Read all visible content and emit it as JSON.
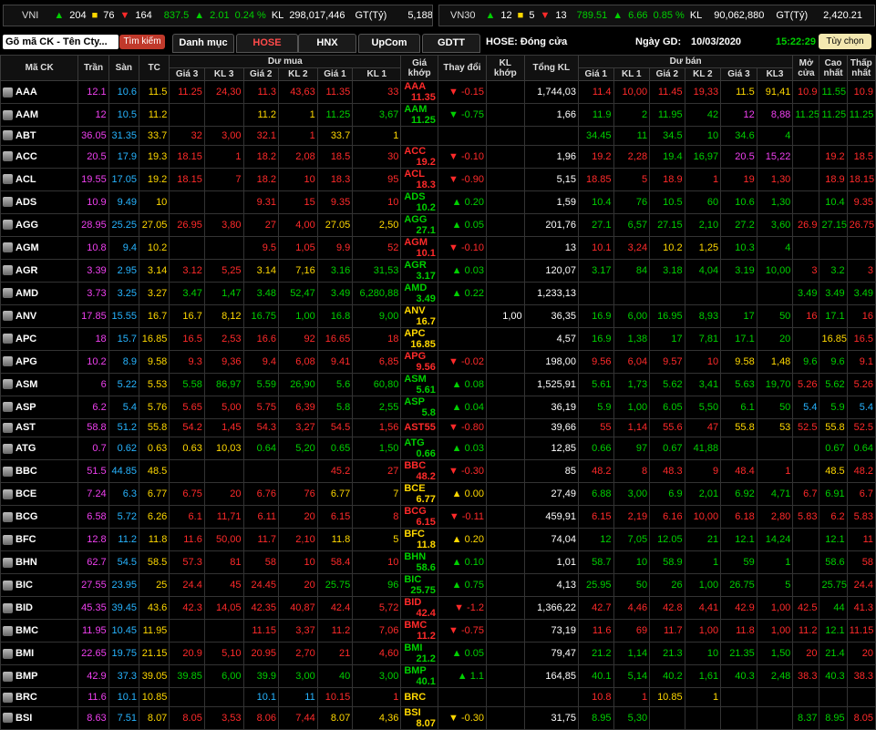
{
  "indices": [
    {
      "name": "VNI",
      "up_count": "204",
      "ref_count": "76",
      "down_count": "164",
      "value": "837.5",
      "change": "2.01",
      "pct": "0.24 %",
      "kl_label": "KL",
      "kl": "298,017,446",
      "gt_label": "GT(Tỷ)",
      "gt": "5,188.53"
    },
    {
      "name": "VN30",
      "up_count": "12",
      "ref_count": "5",
      "down_count": "13",
      "value": "789.51",
      "change": "6.66",
      "pct": "0.85 %",
      "kl_label": "KL",
      "kl": "90,062,880",
      "gt_label": "GT(Tỷ)",
      "gt": "2,420.21"
    }
  ],
  "toolbar": {
    "search_placeholder": "Gõ mã CK - Tên Cty...",
    "search_button": "Tìm kiếm",
    "tabs": [
      "Danh mục",
      "HOSE",
      "HNX",
      "UpCom",
      "GDTT"
    ],
    "market_status": "HOSE: Đóng cửa",
    "date_label": "Ngày GD:",
    "date": "10/03/2020",
    "clock": "15:22:29",
    "custom_button": "Tùy chọn"
  },
  "columns": {
    "code": "Mã CK",
    "ceil": "Trần",
    "floor": "Sàn",
    "ref": "TC",
    "buy_group": "Dư mua",
    "buy": [
      "Giá 3",
      "KL 3",
      "Giá 2",
      "KL 2",
      "Giá 1",
      "KL 1"
    ],
    "match_price": "Giá khớp",
    "change": "Thay đổi",
    "match_vol": "KL khớp",
    "total_vol": "Tổng KL",
    "sell_group": "Dư bán",
    "sell": [
      "Giá 1",
      "KL 1",
      "Giá 2",
      "KL 2",
      "Giá 3",
      "KL3"
    ],
    "open": "Mở cửa",
    "high": "Cao nhất",
    "low": "Thấp nhất"
  },
  "colors": {
    "up": "#00d000",
    "down": "#ff2a2a",
    "ref": "#ffd800",
    "ceil": "#f040f0",
    "floor": "#27b4ff"
  },
  "rows": [
    [
      "AAA",
      "12.1",
      "10.6",
      "11.5",
      "11.25",
      "24,30",
      "11.3",
      "43,63",
      "11.35",
      "33",
      "11.35",
      "▼ -0.15",
      "",
      "1,744,03",
      "11.4",
      "10,00",
      "11.45",
      "19,33",
      "11.5",
      "91,41",
      "10.9",
      "11.55",
      "10.9"
    ],
    [
      "AAM",
      "12",
      "10.5",
      "11.2",
      "",
      "",
      "11.2",
      "1",
      "11.25",
      "3,67",
      "11.25",
      "▼ -0.75",
      "",
      "1,66",
      "11.9",
      "2",
      "11.95",
      "42",
      "12",
      "8,88",
      "11.25",
      "11.25",
      "11.25"
    ],
    [
      "ABT",
      "36.05",
      "31.35",
      "33.7",
      "32",
      "3,00",
      "32.1",
      "1",
      "33.7",
      "1",
      "",
      "",
      "",
      "",
      "34.45",
      "11",
      "34.5",
      "10",
      "34.6",
      "4",
      "",
      "",
      ""
    ],
    [
      "ACC",
      "20.5",
      "17.9",
      "19.3",
      "18.15",
      "1",
      "18.2",
      "2,08",
      "18.5",
      "30",
      "19.2",
      "▼ -0.10",
      "",
      "1,96",
      "19.2",
      "2,28",
      "19.4",
      "16,97",
      "20.5",
      "15,22",
      "",
      "19.2",
      "18.5"
    ],
    [
      "ACL",
      "19.55",
      "17.05",
      "19.2",
      "18.15",
      "7",
      "18.2",
      "10",
      "18.3",
      "95",
      "18.3",
      "▼ -0.90",
      "",
      "5,15",
      "18.85",
      "5",
      "18.9",
      "1",
      "19",
      "1,30",
      "",
      "18.9",
      "18.15"
    ],
    [
      "ADS",
      "10.9",
      "9.49",
      "10",
      "",
      "",
      "9.31",
      "15",
      "9.35",
      "10",
      "10.2",
      "▲ 0.20",
      "",
      "1,59",
      "10.4",
      "76",
      "10.5",
      "60",
      "10.6",
      "1,30",
      "",
      "10.4",
      "9.35"
    ],
    [
      "AGG",
      "28.95",
      "25.25",
      "27.05",
      "26.95",
      "3,80",
      "27",
      "4,00",
      "27.05",
      "2,50",
      "27.1",
      "▲ 0.05",
      "",
      "201,76",
      "27.1",
      "6,57",
      "27.15",
      "2,10",
      "27.2",
      "3,60",
      "26.9",
      "27.15",
      "26.75"
    ],
    [
      "AGM",
      "10.8",
      "9.4",
      "10.2",
      "",
      "",
      "9.5",
      "1,05",
      "9.9",
      "52",
      "10.1",
      "▼ -0.10",
      "",
      "13",
      "10.1",
      "3,24",
      "10.2",
      "1,25",
      "10.3",
      "4",
      "",
      "",
      ""
    ],
    [
      "AGR",
      "3.39",
      "2.95",
      "3.14",
      "3.12",
      "5,25",
      "3.14",
      "7,16",
      "3.16",
      "31,53",
      "3.17",
      "▲ 0.03",
      "",
      "120,07",
      "3.17",
      "84",
      "3.18",
      "4,04",
      "3.19",
      "10,00",
      "3",
      "3.2",
      "3"
    ],
    [
      "AMD",
      "3.73",
      "3.25",
      "3.27",
      "3.47",
      "1,47",
      "3.48",
      "52,47",
      "3.49",
      "6,280,88",
      "3.49",
      "▲ 0.22",
      "",
      "1,233,13",
      "",
      "",
      "",
      "",
      "",
      "",
      "3.49",
      "3.49",
      "3.49"
    ],
    [
      "ANV",
      "17.85",
      "15.55",
      "16.7",
      "16.7",
      "8,12",
      "16.75",
      "1,00",
      "16.8",
      "9,00",
      "16.7",
      "",
      "1,00",
      "36,35",
      "16.9",
      "6,00",
      "16.95",
      "8,93",
      "17",
      "50",
      "16",
      "17.1",
      "16"
    ],
    [
      "APC",
      "18",
      "15.7",
      "16.85",
      "16.5",
      "2,53",
      "16.6",
      "92",
      "16.65",
      "18",
      "16.85",
      "",
      "",
      "4,57",
      "16.9",
      "1,38",
      "17",
      "7,81",
      "17.1",
      "20",
      "",
      "16.85",
      "16.5"
    ],
    [
      "APG",
      "10.2",
      "8.9",
      "9.58",
      "9.3",
      "9,36",
      "9.4",
      "6,08",
      "9.41",
      "6,85",
      "9.56",
      "▼ -0.02",
      "",
      "198,00",
      "9.56",
      "6,04",
      "9.57",
      "10",
      "9.58",
      "1,48",
      "9.6",
      "9.6",
      "9.1"
    ],
    [
      "ASM",
      "6",
      "5.22",
      "5.53",
      "5.58",
      "86,97",
      "5.59",
      "26,90",
      "5.6",
      "60,80",
      "5.61",
      "▲ 0.08",
      "",
      "1,525,91",
      "5.61",
      "1,73",
      "5.62",
      "3,41",
      "5.63",
      "19,70",
      "5.26",
      "5.62",
      "5.26"
    ],
    [
      "ASP",
      "6.2",
      "5.4",
      "5.76",
      "5.65",
      "5,00",
      "5.75",
      "6,39",
      "5.8",
      "2,55",
      "5.8",
      "▲ 0.04",
      "",
      "36,19",
      "5.9",
      "1,00",
      "6.05",
      "5,50",
      "6.1",
      "50",
      "5.4",
      "5.9",
      "5.4"
    ],
    [
      "AST",
      "58.8",
      "51.2",
      "55.8",
      "54.2",
      "1,45",
      "54.3",
      "3,27",
      "54.5",
      "1,56",
      "55",
      "▼ -0.80",
      "",
      "39,66",
      "55",
      "1,14",
      "55.6",
      "47",
      "55.8",
      "53",
      "52.5",
      "55.8",
      "52.5"
    ],
    [
      "ATG",
      "0.7",
      "0.62",
      "0.63",
      "0.63",
      "10,03",
      "0.64",
      "5,20",
      "0.65",
      "1,50",
      "0.66",
      "▲ 0.03",
      "",
      "12,85",
      "0.66",
      "97",
      "0.67",
      "41,88",
      "",
      "",
      "",
      "0.67",
      "0.64"
    ],
    [
      "BBC",
      "51.5",
      "44.85",
      "48.5",
      "",
      "",
      "",
      "",
      "45.2",
      "27",
      "48.2",
      "▼ -0.30",
      "",
      "85",
      "48.2",
      "8",
      "48.3",
      "9",
      "48.4",
      "1",
      "",
      "48.5",
      "48.2"
    ],
    [
      "BCE",
      "7.24",
      "6.3",
      "6.77",
      "6.75",
      "20",
      "6.76",
      "76",
      "6.77",
      "7",
      "6.77",
      "▲ 0.00",
      "",
      "27,49",
      "6.88",
      "3,00",
      "6.9",
      "2,01",
      "6.92",
      "4,71",
      "6.7",
      "6.91",
      "6.7"
    ],
    [
      "BCG",
      "6.58",
      "5.72",
      "6.26",
      "6.1",
      "11,71",
      "6.11",
      "20",
      "6.15",
      "8",
      "6.15",
      "▼ -0.11",
      "",
      "459,91",
      "6.15",
      "2,19",
      "6.16",
      "10,00",
      "6.18",
      "2,80",
      "5.83",
      "6.2",
      "5.83"
    ],
    [
      "BFC",
      "12.8",
      "11.2",
      "11.8",
      "11.6",
      "50,00",
      "11.7",
      "2,10",
      "11.8",
      "5",
      "11.8",
      "▲ 0.20",
      "",
      "74,04",
      "12",
      "7,05",
      "12.05",
      "21",
      "12.1",
      "14,24",
      "",
      "12.1",
      "11"
    ],
    [
      "BHN",
      "62.7",
      "54.5",
      "58.5",
      "57.3",
      "81",
      "58",
      "10",
      "58.4",
      "10",
      "58.6",
      "▲ 0.10",
      "",
      "1,01",
      "58.7",
      "10",
      "58.9",
      "1",
      "59",
      "1",
      "",
      "58.6",
      "58"
    ],
    [
      "BIC",
      "27.55",
      "23.95",
      "25",
      "24.4",
      "45",
      "24.45",
      "20",
      "25.75",
      "96",
      "25.75",
      "▲ 0.75",
      "",
      "4,13",
      "25.95",
      "50",
      "26",
      "1,00",
      "26.75",
      "5",
      "",
      "25.75",
      "24.4"
    ],
    [
      "BID",
      "45.35",
      "39.45",
      "43.6",
      "42.3",
      "14,05",
      "42.35",
      "40,87",
      "42.4",
      "5,72",
      "42.4",
      "▼ -1.2",
      "",
      "1,366,22",
      "42.7",
      "4,46",
      "42.8",
      "4,41",
      "42.9",
      "1,00",
      "42.5",
      "44",
      "41.3"
    ],
    [
      "BMC",
      "11.95",
      "10.45",
      "11.95",
      "",
      "",
      "11.15",
      "3,37",
      "11.2",
      "7,06",
      "11.2",
      "▼ -0.75",
      "",
      "73,19",
      "11.6",
      "69",
      "11.7",
      "1,00",
      "11.8",
      "1,00",
      "11.2",
      "12.1",
      "11.15"
    ],
    [
      "BMI",
      "22.65",
      "19.75",
      "21.15",
      "20.9",
      "5,10",
      "20.95",
      "2,70",
      "21",
      "4,60",
      "21.2",
      "▲ 0.05",
      "",
      "79,47",
      "21.2",
      "1,14",
      "21.3",
      "10",
      "21.35",
      "1,50",
      "20",
      "21.4",
      "20"
    ],
    [
      "BMP",
      "42.9",
      "37.3",
      "39.05",
      "39.85",
      "6,00",
      "39.9",
      "3,00",
      "40",
      "3,00",
      "40.1",
      "▲ 1.1",
      "",
      "164,85",
      "40.1",
      "5,14",
      "40.2",
      "1,61",
      "40.3",
      "2,48",
      "38.3",
      "40.3",
      "38.3"
    ],
    [
      "BRC",
      "11.6",
      "10.1",
      "10.85",
      "",
      "",
      "10.1",
      "11",
      "10.15",
      "1",
      "",
      "",
      "",
      "",
      "10.8",
      "1",
      "10.85",
      "1",
      "",
      "",
      "",
      "",
      ""
    ],
    [
      "BSI",
      "8.63",
      "7.51",
      "8.07",
      "8.05",
      "3,53",
      "8.06",
      "7,44",
      "8.07",
      "4,36",
      "8.07",
      "▼ -0.30",
      "",
      "31,75",
      "8.95",
      "5,30",
      "",
      "",
      "",
      "",
      "8.37",
      "8.95",
      "8.05"
    ]
  ]
}
